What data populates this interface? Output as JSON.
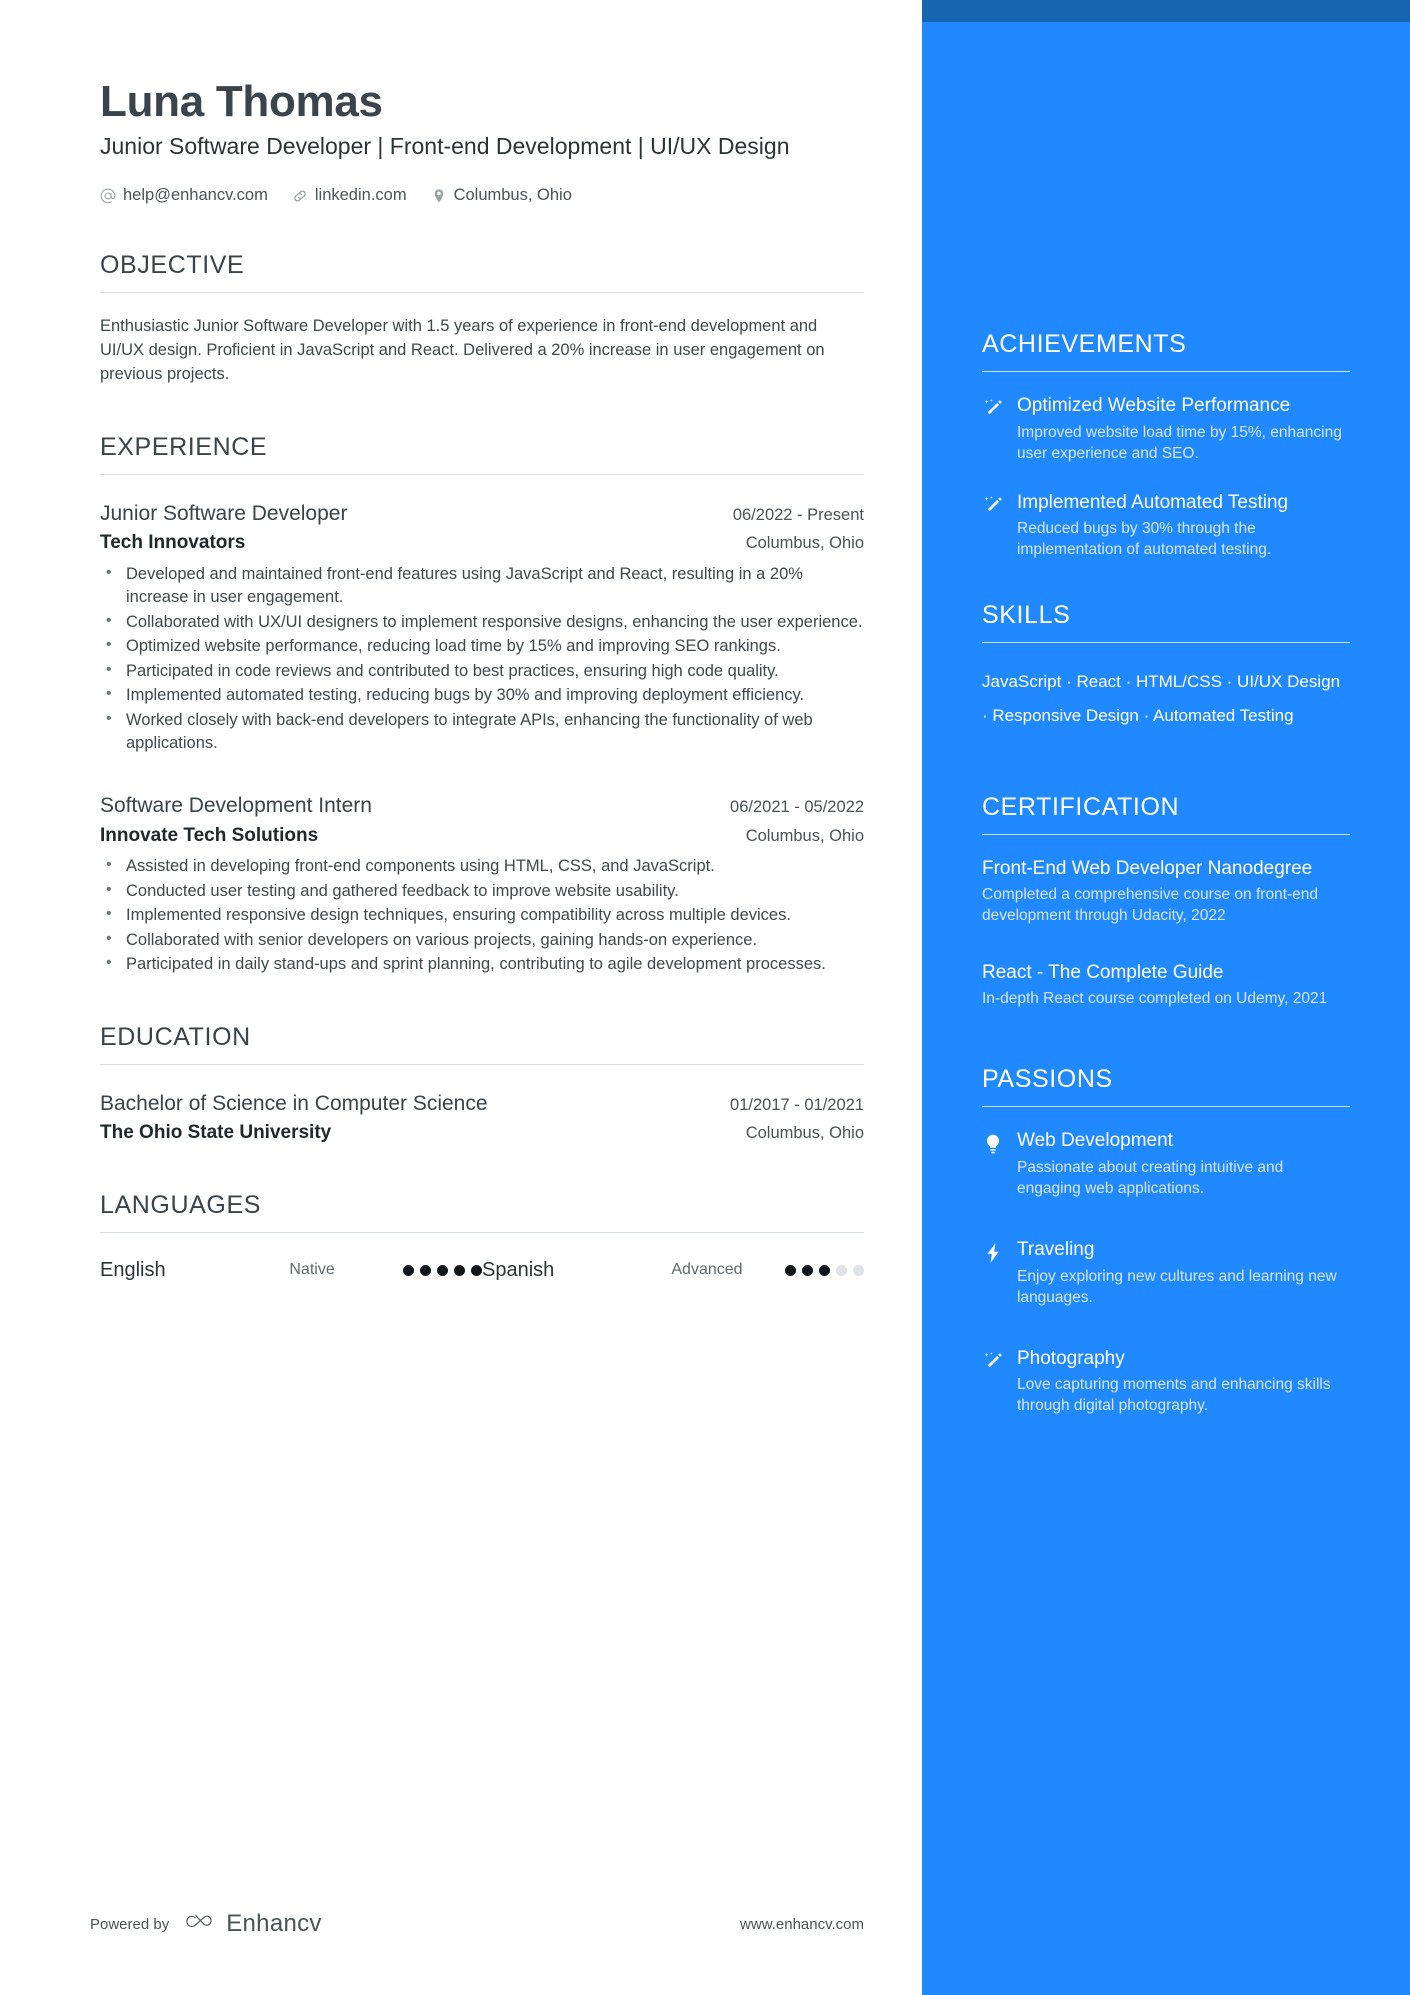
{
  "colors": {
    "sidebar_blue": "#2089ff",
    "sidebar_topbar_blue": "#1565b0",
    "heading_dark": "#3a444a",
    "body_text": "#3f484c",
    "muted_blue_text": "#d5e6fb"
  },
  "header": {
    "name": "Luna Thomas",
    "headline": "Junior Software Developer | Front-end Development | UI/UX Design",
    "contacts": [
      {
        "icon": "at-sign-icon",
        "text": "help@enhancv.com"
      },
      {
        "icon": "link-icon",
        "text": "linkedin.com"
      },
      {
        "icon": "map-pin-icon",
        "text": "Columbus, Ohio"
      }
    ]
  },
  "objective": {
    "title": "OBJECTIVE",
    "text": "Enthusiastic Junior Software Developer with 1.5 years of experience in front-end development and UI/UX design. Proficient in JavaScript and React. Delivered a 20% increase in user engagement on previous projects."
  },
  "experience": {
    "title": "EXPERIENCE",
    "entries": [
      {
        "role": "Junior Software Developer",
        "dates": "06/2022 - Present",
        "company": "Tech Innovators",
        "location": "Columbus, Ohio",
        "bullets": [
          "Developed and maintained front-end features using JavaScript and React, resulting in a 20% increase in user engagement.",
          "Collaborated with UX/UI designers to implement responsive designs, enhancing the user experience.",
          "Optimized website performance, reducing load time by 15% and improving SEO rankings.",
          "Participated in code reviews and contributed to best practices, ensuring high code quality.",
          "Implemented automated testing, reducing bugs by 30% and improving deployment efficiency.",
          "Worked closely with back-end developers to integrate APIs, enhancing the functionality of web applications."
        ]
      },
      {
        "role": "Software Development Intern",
        "dates": "06/2021 - 05/2022",
        "company": "Innovate Tech Solutions",
        "location": "Columbus, Ohio",
        "bullets": [
          "Assisted in developing front-end components using HTML, CSS, and JavaScript.",
          "Conducted user testing and gathered feedback to improve website usability.",
          "Implemented responsive design techniques, ensuring compatibility across multiple devices.",
          "Collaborated with senior developers on various projects, gaining hands-on experience.",
          "Participated in daily stand-ups and sprint planning, contributing to agile development processes."
        ]
      }
    ]
  },
  "education": {
    "title": "EDUCATION",
    "entries": [
      {
        "degree": "Bachelor of Science in Computer Science",
        "dates": "01/2017 - 01/2021",
        "school": "The Ohio State University",
        "location": "Columbus, Ohio"
      }
    ]
  },
  "languages": {
    "title": "LANGUAGES",
    "items": [
      {
        "name": "English",
        "level": "Native",
        "filled": 5,
        "total": 5
      },
      {
        "name": "Spanish",
        "level": "Advanced",
        "filled": 3,
        "total": 5
      }
    ]
  },
  "achievements": {
    "title": "ACHIEVEMENTS",
    "items": [
      {
        "icon": "magic-wand-icon",
        "title": "Optimized Website Performance",
        "desc": "Improved website load time by 15%, enhancing user experience and SEO."
      },
      {
        "icon": "magic-wand-icon",
        "title": "Implemented Automated Testing",
        "desc": "Reduced bugs by 30% through the implementation of automated testing."
      }
    ]
  },
  "skills": {
    "title": "SKILLS",
    "text": "JavaScript · React · HTML/CSS · UI/UX Design · Responsive Design · Automated Testing",
    "items": [
      "JavaScript",
      "React",
      "HTML/CSS",
      "UI/UX Design",
      "Responsive Design",
      "Automated Testing"
    ]
  },
  "certification": {
    "title": "CERTIFICATION",
    "entries": [
      {
        "name": "Front-End Web Developer Nanodegree",
        "desc": "Completed a comprehensive course on front-end development through Udacity, 2022"
      },
      {
        "name": "React - The Complete Guide",
        "desc": "In-depth React course completed on Udemy, 2021"
      }
    ]
  },
  "passions": {
    "title": "PASSIONS",
    "items": [
      {
        "icon": "lightbulb-icon",
        "title": "Web Development",
        "desc": "Passionate about creating intuitive and engaging web applications."
      },
      {
        "icon": "lightning-bolt-icon",
        "title": "Traveling",
        "desc": "Enjoy exploring new cultures and learning new languages."
      },
      {
        "icon": "magic-wand-icon",
        "title": "Photography",
        "desc": "Love capturing moments and enhancing skills through digital photography."
      }
    ]
  },
  "footer": {
    "powered_by": "Powered by",
    "brand": "Enhancv",
    "website": "www.enhancv.com"
  }
}
